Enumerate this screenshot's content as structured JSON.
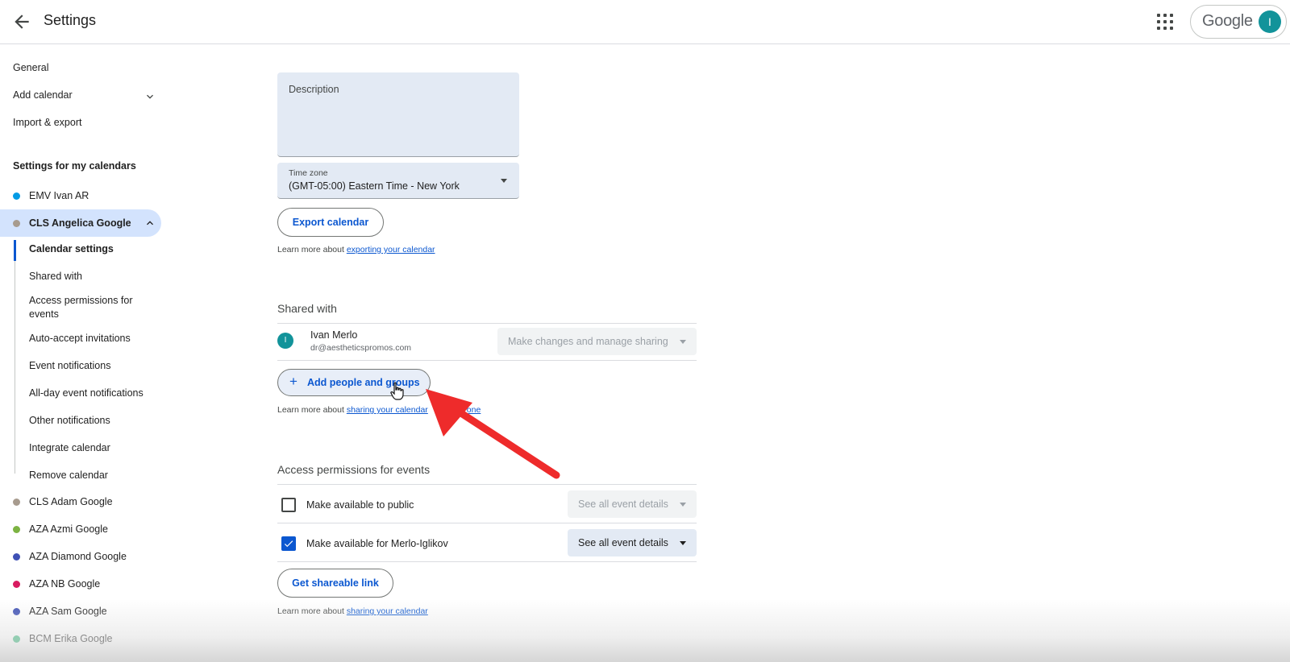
{
  "header": {
    "title": "Settings",
    "back_icon": "arrow-back-icon",
    "apps_icon": "apps-grid-icon",
    "account_brand": "Google",
    "account_initial": "I"
  },
  "sidebar": {
    "general": "General",
    "add_calendar": "Add calendar",
    "import_export": "Import & export",
    "section_title": "Settings for my calendars",
    "calendars_top": [
      {
        "label": "EMV Ivan AR",
        "color": "#039be5"
      },
      {
        "label": "CLS Angelica Google",
        "color": "#a79b8e"
      }
    ],
    "sub_items": [
      "Calendar settings",
      "Shared with",
      "Access permissions for events",
      "Auto-accept invitations",
      "Event notifications",
      "All-day event notifications",
      "Other notifications",
      "Integrate calendar",
      "Remove calendar"
    ],
    "calendars_bottom": [
      {
        "label": "CLS Adam Google",
        "color": "#a79b8e"
      },
      {
        "label": "AZA Azmi Google",
        "color": "#7cb342"
      },
      {
        "label": "AZA Diamond Google",
        "color": "#3f51b5"
      },
      {
        "label": "AZA NB Google",
        "color": "#d81b60"
      },
      {
        "label": "AZA Sam Google",
        "color": "#3f51b5"
      },
      {
        "label": "BCM Erika Google",
        "color": "#33b679"
      }
    ]
  },
  "main": {
    "description_label": "Description",
    "timezone_label": "Time zone",
    "timezone_value": "(GMT-05:00) Eastern Time - New York",
    "export_button": "Export calendar",
    "export_learn_prefix": "Learn more about ",
    "export_learn_link": "exporting your calendar",
    "shared_heading": "Shared with",
    "person": {
      "initial": "I",
      "name": "Ivan Merlo",
      "email": "dr@aestheticspromos.com",
      "permission": "Make changes and manage sharing"
    },
    "add_people_button": "Add people and groups",
    "sharing_learn_prefix": "Learn more about ",
    "sharing_learn_link": "sharing your calendar",
    "sharing_learn_link_end": "one",
    "access_heading": "Access permissions for events",
    "public_label": "Make available to public",
    "public_select": "See all event details",
    "org_label": "Make available for Merlo-Iglikov",
    "org_select": "See all event details",
    "shareable_button": "Get shareable link",
    "shareable_learn_prefix": "Learn more about ",
    "shareable_learn_link": "sharing your calendar"
  },
  "annotation": {
    "arrow_color": "#ee2b2b",
    "cursor_icon": "hand-pointer-icon"
  }
}
